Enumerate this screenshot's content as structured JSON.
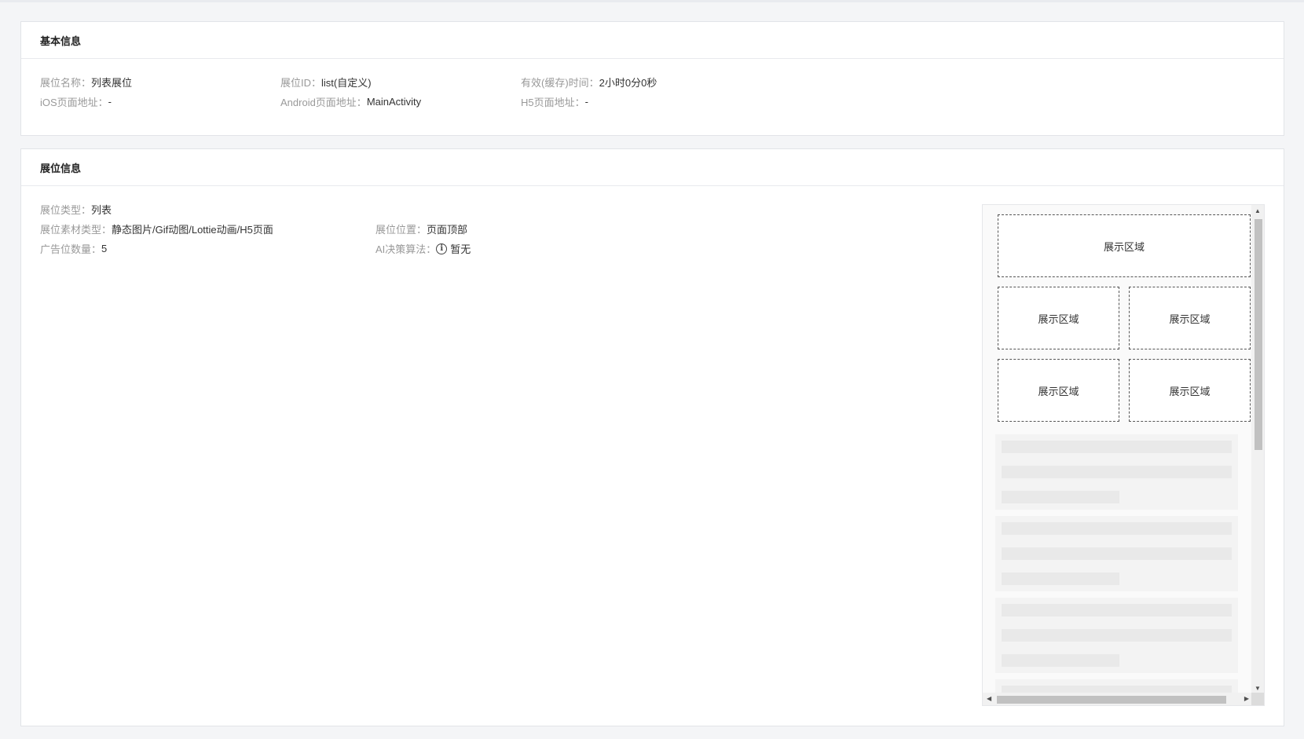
{
  "basic_info": {
    "title": "基本信息",
    "fields": [
      {
        "label": "展位名称：",
        "value": "列表展位"
      },
      {
        "label": "展位ID：",
        "value": "list(自定义)"
      },
      {
        "label": "有效(缓存)时间：",
        "value": "2小时0分0秒"
      },
      {
        "label": "iOS页面地址：",
        "value": "-"
      },
      {
        "label": "Android页面地址：",
        "value": "MainActivity"
      },
      {
        "label": "H5页面地址：",
        "value": "-"
      }
    ]
  },
  "slot_info": {
    "title": "展位信息",
    "fields": [
      {
        "label": "展位类型：",
        "value": "列表"
      },
      {
        "label": "展位素材类型：",
        "value": "静态图片/Gif动图/Lottie动画/H5页面"
      },
      {
        "label": "展位位置：",
        "value": "页面顶部"
      },
      {
        "label": "广告位数量：",
        "value": "5"
      },
      {
        "label": "AI决策算法：",
        "value": "暂无",
        "icon": "info-circle-icon"
      }
    ],
    "preview": {
      "areas": [
        "展示区域",
        "展示区域",
        "展示区域",
        "展示区域",
        "展示区域"
      ],
      "placeholder_cards": 3
    }
  },
  "colors": {
    "page_bg": "#f4f5f7",
    "card_bg": "#ffffff",
    "label": "#999999",
    "value": "#333333",
    "dashed_border": "#555555",
    "scrollbar_thumb": "#c1c1c1"
  }
}
